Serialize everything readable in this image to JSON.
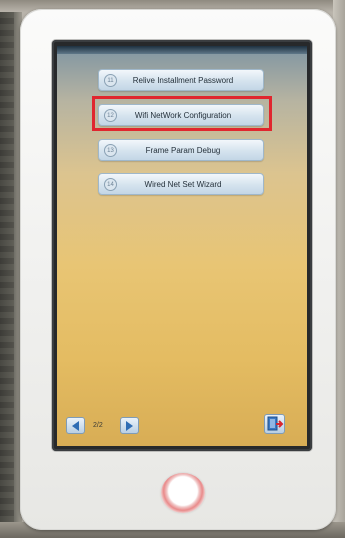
{
  "menu": {
    "items": [
      {
        "number": "11",
        "label": "Relive Installment Password"
      },
      {
        "number": "12",
        "label": "Wifi NetWork Configuration"
      },
      {
        "number": "13",
        "label": "Frame Param Debug"
      },
      {
        "number": "14",
        "label": "Wired Net Set Wizard"
      }
    ],
    "highlighted_index": 1,
    "highlight_color": "#e0262e"
  },
  "pagination": {
    "page_indicator": "2/2",
    "prev_icon": "left-arrow-icon",
    "next_icon": "right-arrow-icon"
  },
  "exit": {
    "icon": "exit-door-icon"
  },
  "device": {
    "home_button_icon": "home-ring-icon"
  }
}
